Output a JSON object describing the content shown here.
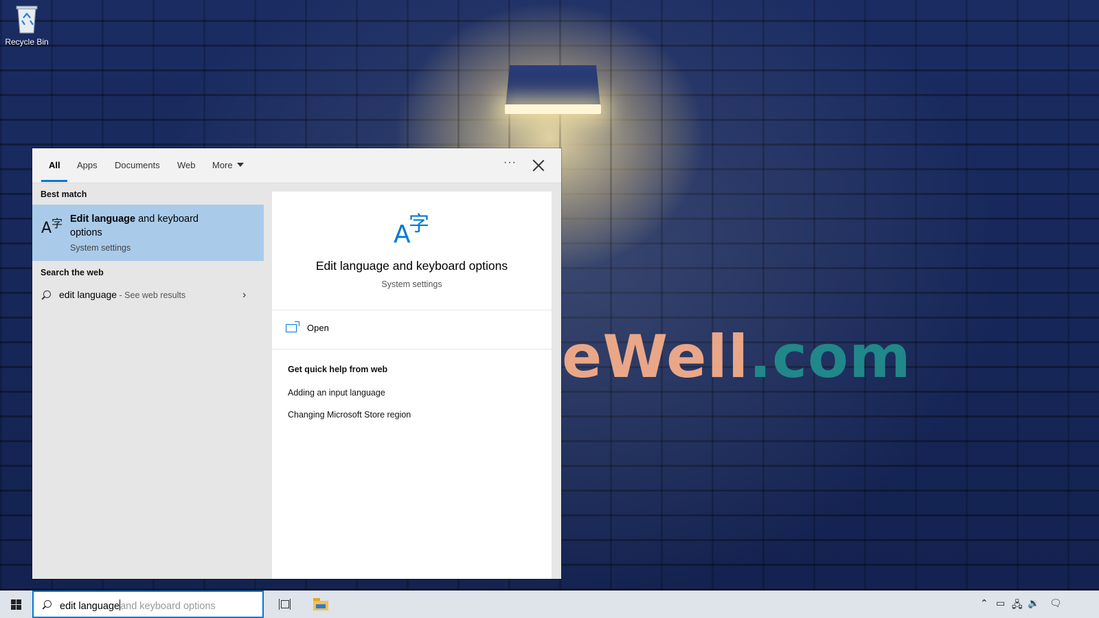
{
  "desktop": {
    "recycle_bin_label": "Recycle Bin",
    "watermark_left": "eWell",
    "watermark_right": ".com"
  },
  "search_panel": {
    "tabs": [
      {
        "label": "All",
        "active": true
      },
      {
        "label": "Apps",
        "active": false
      },
      {
        "label": "Documents",
        "active": false
      },
      {
        "label": "Web",
        "active": false
      },
      {
        "label": "More",
        "active": false
      }
    ],
    "more_options": "···",
    "best_match_heading": "Best match",
    "best_match": {
      "icon": "language-icon",
      "title_bold": "Edit language",
      "title_rest": " and keyboard options",
      "subtitle": "System settings"
    },
    "web_heading": "Search the web",
    "web_result": {
      "query": "edit language",
      "suffix": " - See web results"
    },
    "detail": {
      "icon_a": "A",
      "icon_char": "字",
      "title": "Edit language and keyboard options",
      "subtitle": "System settings",
      "open_label": "Open",
      "help_heading": "Get quick help from web",
      "help_links": [
        "Adding an input language",
        "Changing Microsoft Store region"
      ]
    }
  },
  "taskbar": {
    "search_typed": "edit language",
    "search_suggestion": "and keyboard options",
    "tray_icons": [
      "chevron-up-icon",
      "battery-icon",
      "network-icon",
      "volume-icon",
      "action-center-icon"
    ]
  },
  "colors": {
    "accent": "#0078d7",
    "selected_item": "#a9cbe9",
    "panel_bg": "#e6e6e6",
    "taskbar_bg": "#dfe3ea"
  }
}
